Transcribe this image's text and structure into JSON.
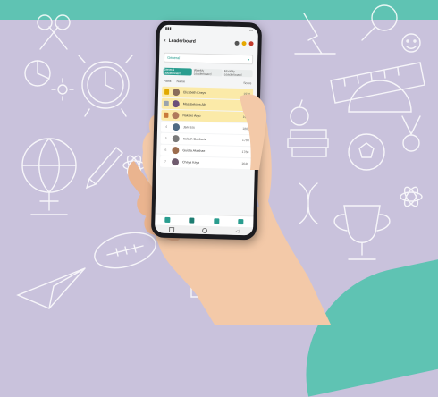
{
  "colors": {
    "background": "#c9c2dc",
    "accent": "#5fc3b3",
    "teal": "#2a9d8f",
    "podium_highlight": "#fbeaa8",
    "doodle_stroke": "#ffffff"
  },
  "app": {
    "title": "Leaderboard",
    "back_icon": "back-arrow-icon",
    "header_icons": [
      "search-icon",
      "trophy-icon",
      "profile-icon"
    ]
  },
  "select": {
    "value": "General",
    "icon": "chevron-down-icon"
  },
  "tabs": [
    {
      "label": "General Leaderboard",
      "active": true
    },
    {
      "label": "Weekly Leaderboard",
      "active": false
    },
    {
      "label": "Monthly Leaderboard",
      "active": false
    }
  ],
  "table": {
    "col_rank": "Rank",
    "col_name": "Name",
    "col_score": "Score"
  },
  "rows": [
    {
      "rank": "1",
      "name": "Elizabeth Kneys",
      "score": "1930",
      "medal": "gold"
    },
    {
      "rank": "2",
      "name": "Mazabekova Alis",
      "score": "1915",
      "medal": "silver"
    },
    {
      "rank": "3",
      "name": "Nakako Argo",
      "score": "1900",
      "medal": "bronze"
    },
    {
      "rank": "4",
      "name": "Jan kiss",
      "score": "1800",
      "medal": ""
    },
    {
      "rank": "5",
      "name": "Kalash Gohbaria",
      "score": "1780",
      "medal": ""
    },
    {
      "rank": "6",
      "name": "Guidra Akashae",
      "score": "1760",
      "medal": ""
    },
    {
      "rank": "7",
      "name": "Chaya Kaya",
      "score": "1640",
      "medal": ""
    }
  ],
  "bottom_nav": [
    "home-icon",
    "chart-icon",
    "book-icon",
    "group-icon"
  ],
  "system_nav": [
    "square-icon",
    "circle-icon",
    "triangle-icon"
  ]
}
